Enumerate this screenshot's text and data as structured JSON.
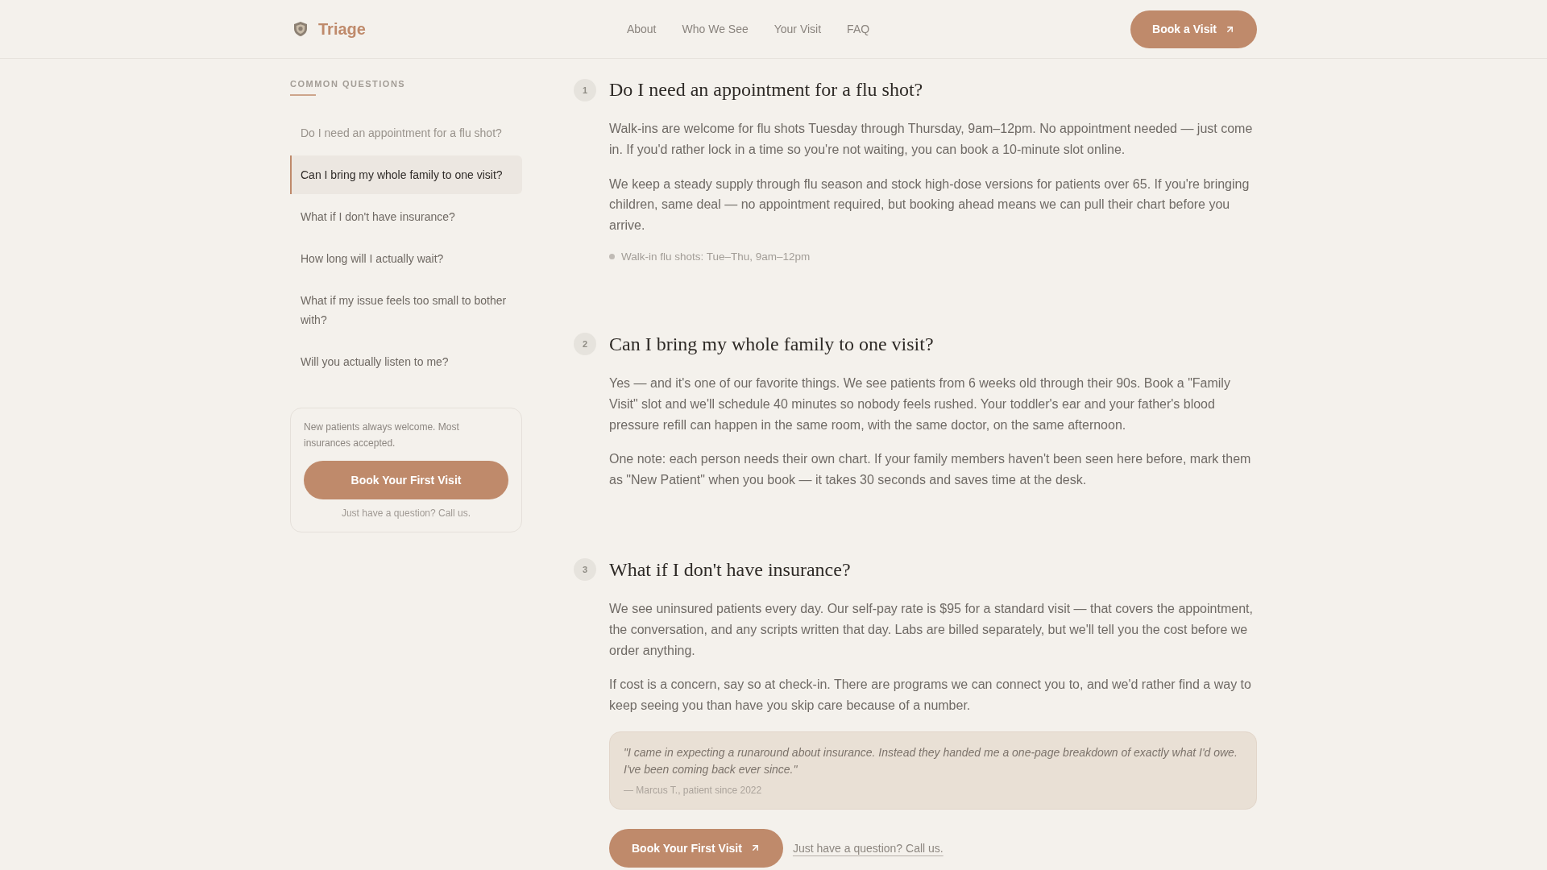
{
  "header": {
    "logo": "Triage",
    "nav": [
      "About",
      "Who We See",
      "Your Visit",
      "FAQ"
    ],
    "button": "Book a Visit"
  },
  "sidebar": {
    "heading": "COMMON QUESTIONS",
    "items": [
      {
        "label": "Do I need an appointment for a flu shot?",
        "selected": false,
        "dimmed": true
      },
      {
        "label": "Can I bring my whole family to one visit?",
        "selected": true,
        "dimmed": false
      },
      {
        "label": "What if I don't have insurance?",
        "selected": false,
        "dimmed": false
      },
      {
        "label": "How long will I actually wait?",
        "selected": false,
        "dimmed": false
      },
      {
        "label": "What if my issue feels too small to bother with?",
        "selected": false,
        "dimmed": false
      },
      {
        "label": "Will you actually listen to me?",
        "selected": false,
        "dimmed": false
      }
    ],
    "card": {
      "text": "New patients always welcome. Most insurances accepted.",
      "button": "Book Your First Visit",
      "note": "Just have a question? Call us."
    }
  },
  "sections": [
    {
      "number": "1",
      "title": "Do I need an appointment for a flu shot?",
      "paragraphs": [
        "Walk-ins are welcome for flu shots Tuesday through Thursday, 9am–12pm. No appointment needed — just come in. If you'd rather lock in a time so you're not waiting, you can book a 10-minute slot online.",
        "We keep a steady supply through flu season and stock high-dose versions for patients over 65. If you're bringing children, same deal — no appointment required, but booking ahead means we can pull their chart before you arrive."
      ],
      "note": "Walk-in flu shots: Tue–Thu, 9am–12pm"
    },
    {
      "number": "2",
      "title": "Can I bring my whole family to one visit?",
      "paragraphs": [
        "Yes — and it's one of our favorite things. We see patients from 6 weeks old through their 90s. Book a \"Family Visit\" slot and we'll schedule 40 minutes so nobody feels rushed. Your toddler's ear and your father's blood pressure refill can happen in the same room, with the same doctor, on the same afternoon.",
        "One note: each person needs their own chart. If your family members haven't been seen here before, mark them as \"New Patient\" when you book — it takes 30 seconds and saves time at the desk."
      ]
    },
    {
      "number": "3",
      "title": "What if I don't have insurance?",
      "paragraphs": [
        "We see uninsured patients every day. Our self-pay rate is $95 for a standard visit — that covers the appointment, the conversation, and any scripts written that day. Labs are billed separately, but we'll tell you the cost before we order anything.",
        "If cost is a concern, say so at check-in. There are programs we can connect you to, and we'd rather find a way to keep seeing you than have you skip care because of a number."
      ],
      "quote": {
        "text": "\"I came in expecting a runaround about insurance. Instead they handed me a one-page breakdown of exactly what I'd owe. I've been coming back ever since.\"",
        "attribution": "— Marcus T., patient since 2022"
      },
      "actions": {
        "button": "Book Your First Visit",
        "link": "Just have a question? Call us."
      }
    }
  ]
}
